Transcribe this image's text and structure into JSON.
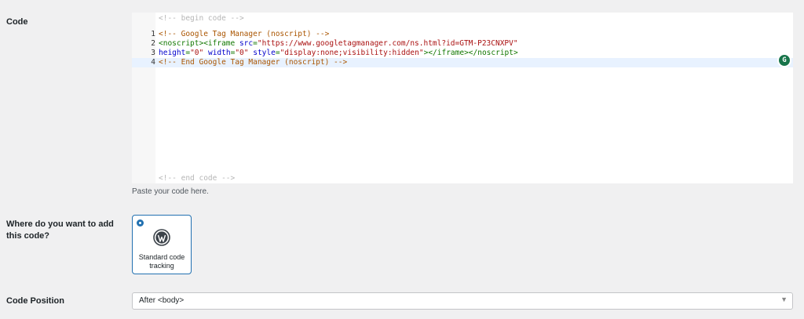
{
  "code_section": {
    "label": "Code",
    "begin_marker": "<!-- begin code -->",
    "end_marker": "<!-- end code -->",
    "lines": [
      {
        "num": "1",
        "parts": [
          {
            "t": "<!-- Google Tag Manager (noscript) -->",
            "c": "comment"
          }
        ]
      },
      {
        "num": "2",
        "parts": [
          {
            "t": "<noscript><iframe ",
            "c": "tag"
          },
          {
            "t": "src",
            "c": "attr"
          },
          {
            "t": "=",
            "c": "tag"
          },
          {
            "t": "\"https://www.googletagmanager.com/ns.html?id=GTM-P23CNXPV\"",
            "c": "str"
          }
        ]
      },
      {
        "num": "3",
        "parts": [
          {
            "t": "height",
            "c": "attr"
          },
          {
            "t": "=",
            "c": "tag"
          },
          {
            "t": "\"0\"",
            "c": "str"
          },
          {
            "t": " ",
            "c": "tag"
          },
          {
            "t": "width",
            "c": "attr"
          },
          {
            "t": "=",
            "c": "tag"
          },
          {
            "t": "\"0\"",
            "c": "str"
          },
          {
            "t": " ",
            "c": "tag"
          },
          {
            "t": "style",
            "c": "attr"
          },
          {
            "t": "=",
            "c": "tag"
          },
          {
            "t": "\"display:none;visibility:hidden\"",
            "c": "str"
          },
          {
            "t": "></iframe></noscript>",
            "c": "tag"
          }
        ]
      },
      {
        "num": "4",
        "parts": [
          {
            "t": "<!-- End Google Tag Manager (noscript) -->",
            "c": "comment"
          }
        ]
      }
    ],
    "help_text": "Paste your code here."
  },
  "location_section": {
    "label": "Where do you want to add this code?",
    "option_label": "Standard code tracking"
  },
  "position_section": {
    "label": "Code Position",
    "selected": "After <body>"
  }
}
